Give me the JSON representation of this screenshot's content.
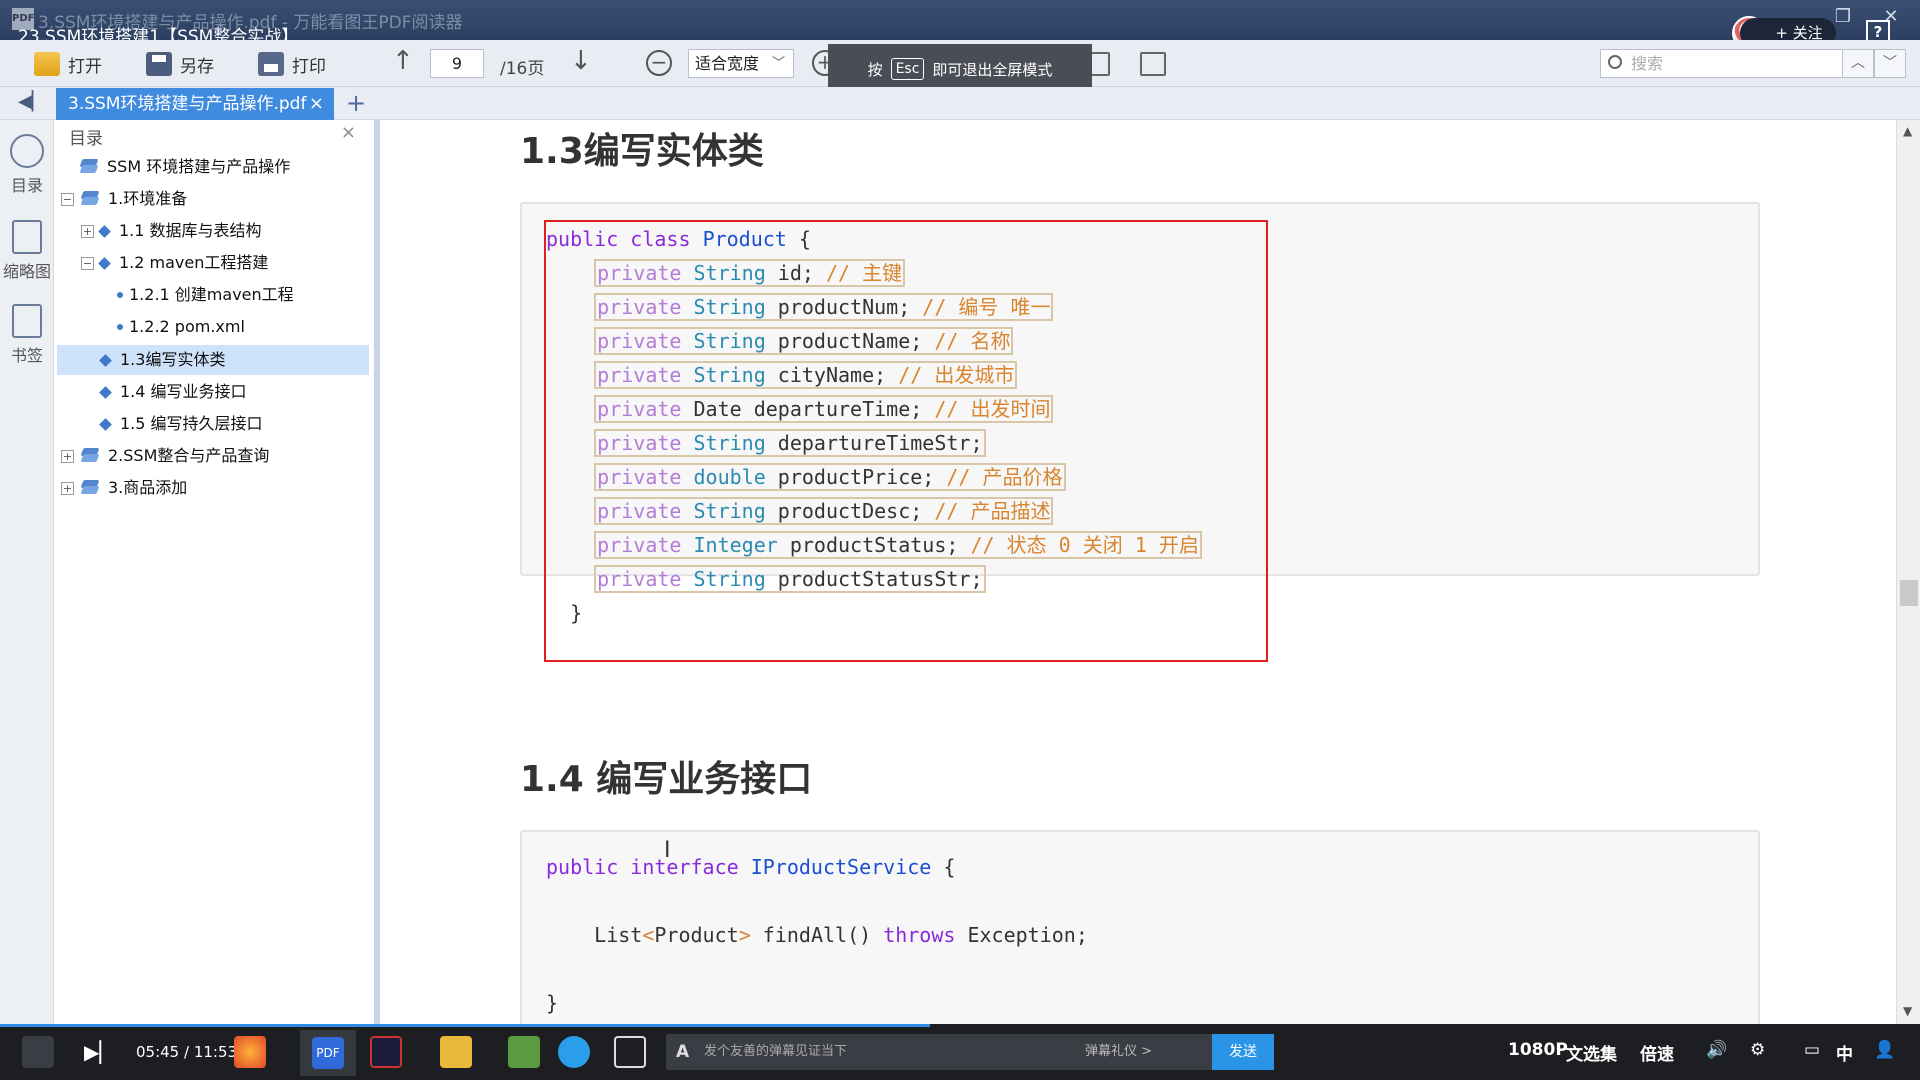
{
  "window": {
    "doc_title": "3.SSM环境搭建与产品操作.pdf - 万能看图王PDF阅读器",
    "video_title": "23.SSM环境搭建1【SSM整合实战】",
    "follow_label": "+ 关注",
    "help_label": "?"
  },
  "toolbar": {
    "open_label": "打开",
    "saveas_label": "另存",
    "print_label": "打印",
    "page_current": "9",
    "page_total": "/16页",
    "fit_mode": "适合宽度",
    "search_placeholder": "搜索",
    "esc_prefix": "按",
    "esc_key": "Esc",
    "esc_suffix": "即可退出全屏模式"
  },
  "tabs": {
    "doc_tab": "3.SSM环境搭建与产品操作.pdf",
    "close": "×",
    "new_tab": "+"
  },
  "rail": {
    "outline_label": "目录",
    "thumbs_label": "缩略图",
    "bookmarks_label": "书签"
  },
  "outline": {
    "header": "目录",
    "items": [
      {
        "label": "SSM 环境搭建与产品操作"
      },
      {
        "label": "1.环境准备"
      },
      {
        "label": "1.1 数据库与表结构"
      },
      {
        "label": "1.2 maven工程搭建"
      },
      {
        "label": "1.2.1 创建maven工程"
      },
      {
        "label": "1.2.2 pom.xml"
      },
      {
        "label": "1.3编写实体类"
      },
      {
        "label": "1.4 编写业务接口"
      },
      {
        "label": "1.5 编写持久层接口"
      },
      {
        "label": "2.SSM整合与产品查询"
      },
      {
        "label": "3.商品添加"
      }
    ]
  },
  "document": {
    "section1_title": "1.3编写实体类",
    "section2_title": "1.4 编写业务接口",
    "class_decl": {
      "kw1": "public",
      "kw2": "class",
      "name": "Product",
      "brace": " {"
    },
    "fields": [
      {
        "mod": "private",
        "type": "String",
        "name": " id;",
        "comment": " // 主键"
      },
      {
        "mod": "private",
        "type": "String",
        "name": " productNum;",
        "comment": " // 编号 唯一"
      },
      {
        "mod": "private",
        "type": "String",
        "name": " productName;",
        "comment": " // 名称"
      },
      {
        "mod": "private",
        "type": "String",
        "name": " cityName;",
        "comment": " // 出发城市"
      },
      {
        "mod": "private",
        "type": "Date",
        "name": " departureTime;",
        "comment": " // 出发时间"
      },
      {
        "mod": "private",
        "type": "String",
        "name": " departureTimeStr;",
        "comment": ""
      },
      {
        "mod": "private",
        "type": "double",
        "name": " productPrice;",
        "comment": " // 产品价格"
      },
      {
        "mod": "private",
        "type": "String",
        "name": " productDesc;",
        "comment": " // 产品描述"
      },
      {
        "mod": "private",
        "type": "Integer",
        "name": " productStatus;",
        "comment": " // 状态 0 关闭 1 开启"
      },
      {
        "mod": "private",
        "type": "String",
        "name": " productStatusStr;",
        "comment": ""
      }
    ],
    "close_brace": "}",
    "iface": {
      "kw1": "public",
      "kw2": "interface",
      "name": "IProductService",
      "brace": " {"
    },
    "method": {
      "pre": "List",
      "lt": "<",
      "generic": "Product",
      "gt": ">",
      "name": " findAll() ",
      "throws": "throws",
      "exc": " Exception;"
    },
    "iface_close": "}"
  },
  "taskbar": {
    "time": "05:45 / 11:53",
    "danmaku_placeholder": "发个友善的弹幕见证当下",
    "gift_label": "弹幕礼仪 >",
    "send_label": "发送",
    "quality": "1080P",
    "collection": "文选集",
    "speed": "倍速",
    "ime": "中"
  },
  "colors": {
    "accent": "#3e8be0",
    "selection": "#cfe2fb",
    "redbox": "#e01e1e"
  }
}
